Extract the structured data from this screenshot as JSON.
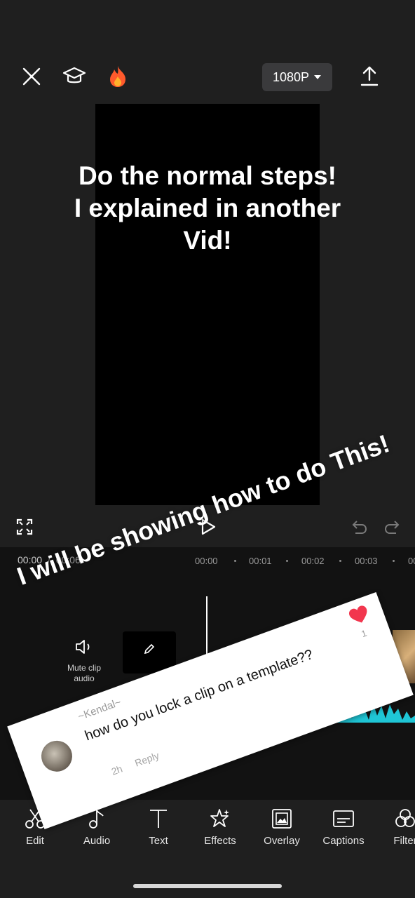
{
  "topbar": {
    "resolution_label": "1080P"
  },
  "preview": {
    "overlay_text": "Do the normal steps!\nI explained in another Vid!"
  },
  "timeline": {
    "current_time": "00:00",
    "separator": "/",
    "total_time": "00:06",
    "ruler": [
      "00:00",
      "00:01",
      "00:02",
      "00:03",
      "00"
    ],
    "mute_label": "Mute clip audio"
  },
  "caption": {
    "text": "I will be showing how to do This!"
  },
  "comment": {
    "username": "~Kendal~",
    "text": "how do you lock a clip on a template??",
    "age": "2h",
    "reply_label": "Reply",
    "likes": "1"
  },
  "toolbar": {
    "items": [
      {
        "label": "Edit",
        "icon": "scissors-icon"
      },
      {
        "label": "Audio",
        "icon": "music-note-icon"
      },
      {
        "label": "Text",
        "icon": "text-icon"
      },
      {
        "label": "Effects",
        "icon": "effects-star-icon"
      },
      {
        "label": "Overlay",
        "icon": "overlay-icon"
      },
      {
        "label": "Captions",
        "icon": "captions-icon"
      },
      {
        "label": "Filter",
        "icon": "filter-icon"
      }
    ]
  },
  "colors": {
    "background": "#1f1f1f",
    "heart": "#f2364e",
    "waveform": "#1fc6d6",
    "fire": "#ff5a2c"
  }
}
